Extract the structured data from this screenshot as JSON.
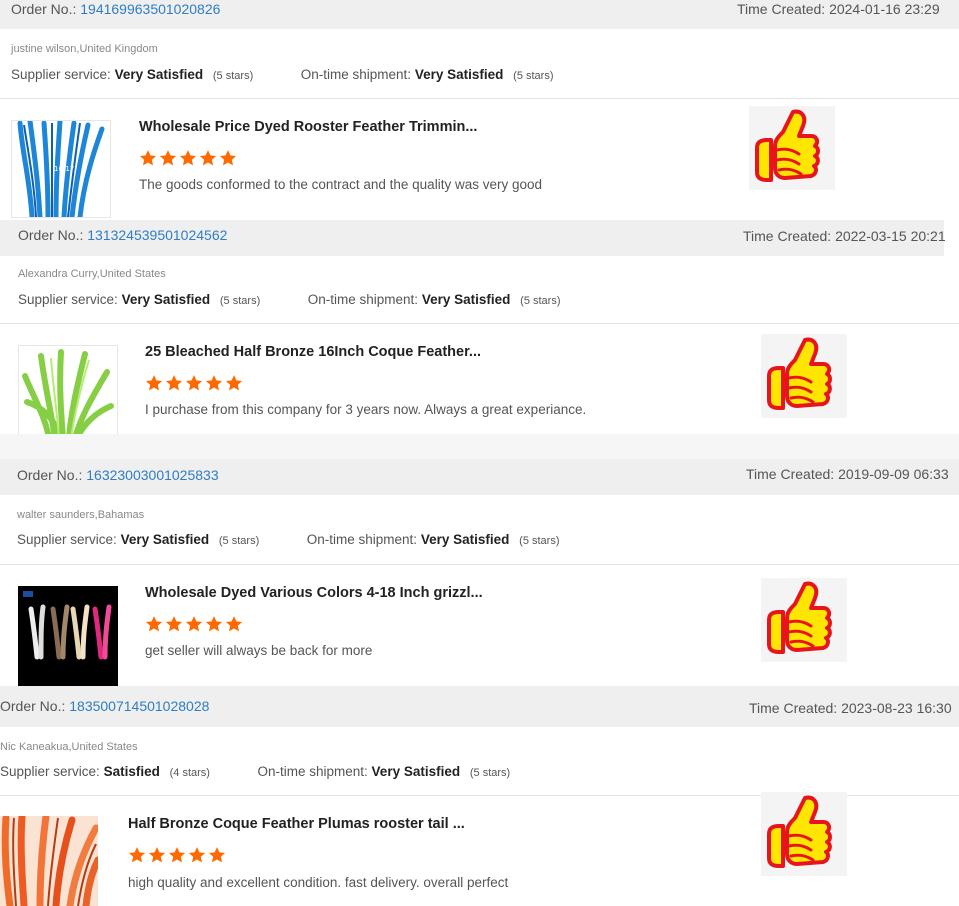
{
  "reviews": [
    {
      "order_label": "Order No.:",
      "order_no": "194169963501020826",
      "time_label": "Time Created:",
      "time": "2024-01-16 23:29",
      "buyer": "justine wilson,United Kingdom",
      "supplier_label": "Supplier service:",
      "supplier_value": "Very Satisfied",
      "supplier_stars": "(5 stars)",
      "shipment_label": "On-time shipment:",
      "shipment_value": "Very Satisfied",
      "shipment_stars": "(5 stars)",
      "product_title": "Wholesale Price Dyed Rooster Feather Trimmin...",
      "rating": 5,
      "comment": "The goods conformed to the contract and the quality was very good",
      "image_color": "#1e86d8",
      "image_text": "16-17"
    },
    {
      "order_label": "Order No.:",
      "order_no": "131324539501024562",
      "time_label": "Time Created:",
      "time": "2022-03-15 20:21",
      "buyer": "Alexandra Curry,United States",
      "supplier_label": "Supplier service:",
      "supplier_value": "Very Satisfied",
      "supplier_stars": "(5 stars)",
      "shipment_label": "On-time shipment:",
      "shipment_value": "Very Satisfied",
      "shipment_stars": "(5 stars)",
      "product_title": "25 Bleached Half Bronze 16Inch Coque Feather...",
      "rating": 5,
      "comment": "I purchase from this company for 3 years now. Always a great experiance.",
      "image_color": "#8bd24a"
    },
    {
      "order_label": "Order No.:",
      "order_no": "16323003001025833",
      "time_label": "Time Created:",
      "time": "2019-09-09 06:33",
      "buyer": "walter saunders,Bahamas",
      "supplier_label": "Supplier service:",
      "supplier_value": "Very Satisfied",
      "supplier_stars": "(5 stars)",
      "shipment_label": "On-time shipment:",
      "shipment_value": "Very Satisfied",
      "shipment_stars": "(5 stars)",
      "product_title": "Wholesale Dyed Various Colors 4-18 Inch grizzl...",
      "rating": 5,
      "comment": "get seller will always be back for more",
      "image_color": "#000000"
    },
    {
      "order_label": "Order No.:",
      "order_no": "183500714501028028",
      "time_label": "Time Created:",
      "time": "2023-08-23 16:30",
      "buyer": "Nic Kaneakua,United States",
      "supplier_label": "Supplier service:",
      "supplier_value": "Satisfied",
      "supplier_stars": "(4 stars)",
      "shipment_label": "On-time shipment:",
      "shipment_value": "Very Satisfied",
      "shipment_stars": "(5 stars)",
      "product_title": "Half Bronze Coque Feather Plumas rooster tail ...",
      "rating": 5,
      "comment": "high quality and excellent condition. fast delivery.   overall perfect",
      "image_color": "#ee5a22"
    }
  ],
  "colors": {
    "star": "#ff6a00",
    "link": "#2f7dc4",
    "bar": "#efefef",
    "thumb_yellow": "#ffe600",
    "thumb_red": "#e8141c"
  },
  "icons": {
    "rating": "star-icon",
    "badge": "thumbs-up-icon"
  }
}
